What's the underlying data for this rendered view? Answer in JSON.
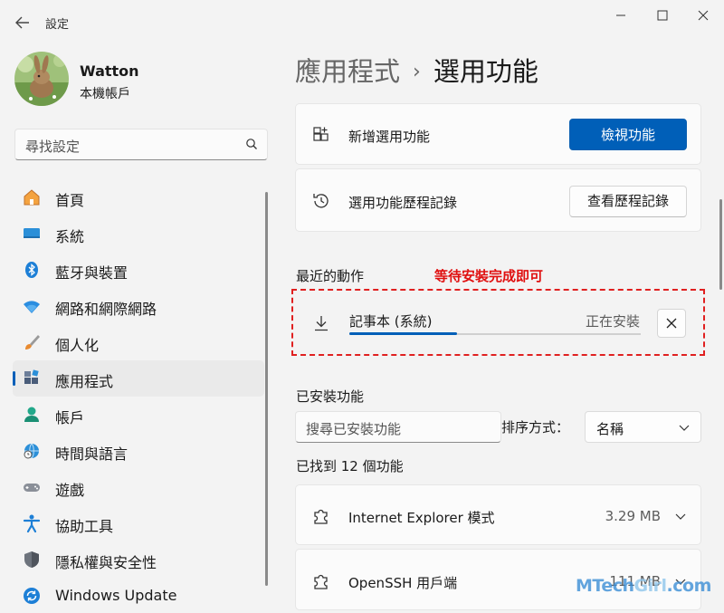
{
  "window": {
    "title": "設定"
  },
  "user": {
    "name": "Watton",
    "account_type": "本機帳戶"
  },
  "search": {
    "placeholder": "尋找設定"
  },
  "sidebar": {
    "items": [
      {
        "label": "首頁",
        "icon": "home-icon"
      },
      {
        "label": "系統",
        "icon": "system-icon"
      },
      {
        "label": "藍牙與裝置",
        "icon": "bluetooth-icon"
      },
      {
        "label": "網路和網際網路",
        "icon": "wifi-icon"
      },
      {
        "label": "個人化",
        "icon": "brush-icon"
      },
      {
        "label": "應用程式",
        "icon": "apps-icon",
        "active": true
      },
      {
        "label": "帳戶",
        "icon": "account-icon"
      },
      {
        "label": "時間與語言",
        "icon": "globe-clock-icon"
      },
      {
        "label": "遊戲",
        "icon": "gamepad-icon"
      },
      {
        "label": "協助工具",
        "icon": "accessibility-icon"
      },
      {
        "label": "隱私權與安全性",
        "icon": "shield-icon"
      },
      {
        "label": "Windows Update",
        "icon": "update-icon"
      }
    ]
  },
  "header": {
    "parent": "應用程式",
    "separator": "›",
    "current": "選用功能"
  },
  "add_feature": {
    "label": "新增選用功能",
    "button": "檢視功能"
  },
  "history": {
    "label": "選用功能歷程記錄",
    "button": "查看歷程記錄"
  },
  "recent": {
    "title": "最近的動作",
    "annotation": "等待安裝完成即可",
    "item": {
      "name": "記事本 (系統)",
      "status": "正在安裝",
      "progress": 0.37
    }
  },
  "installed": {
    "title": "已安裝功能",
    "search_placeholder": "搜尋已安裝功能",
    "sort_label": "排序方式：",
    "sort_value": "名稱",
    "count_text": "已找到 12 個功能",
    "items": [
      {
        "name": "Internet Explorer 模式",
        "size": "3.29 MB"
      },
      {
        "name": "OpenSSH 用戶端",
        "size": "111 MB"
      }
    ]
  },
  "watermark": {
    "part1": "MTech",
    "part2": "Girl",
    "part3": ".com"
  },
  "colors": {
    "accent": "#005fb8",
    "annotation": "#e01010"
  }
}
